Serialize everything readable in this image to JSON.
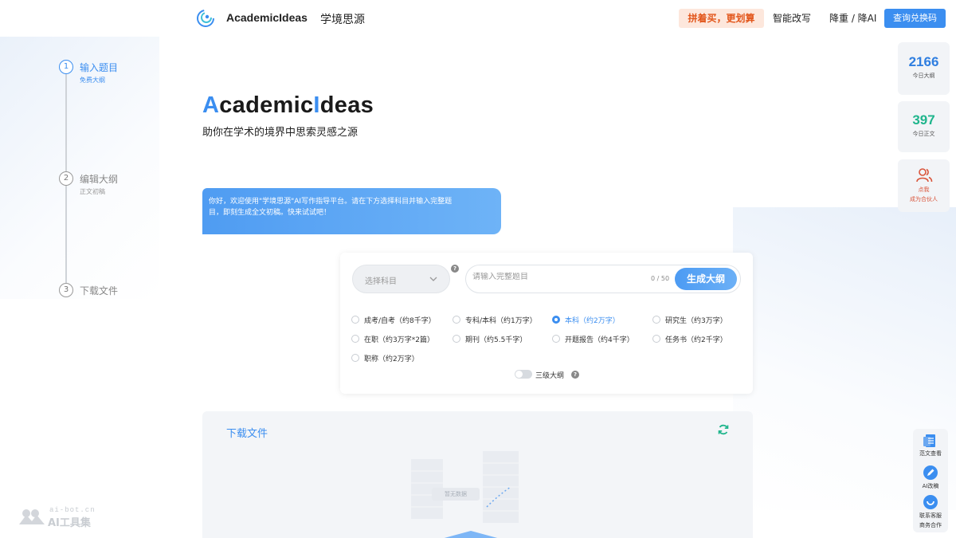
{
  "header": {
    "brand_en": "AcademicIdeas",
    "brand_cn": "学境思源",
    "nav_promo": "拼着买，更划算",
    "nav_rewrite": "智能改写",
    "nav_reduce": "降重 / 降AI",
    "nav_redeem": "查询兑换码"
  },
  "steps": [
    {
      "num": "1",
      "title": "输入题目",
      "sub": "免费大纲"
    },
    {
      "num": "2",
      "title": "编辑大纲",
      "sub": "正文初稿"
    },
    {
      "num": "3",
      "title": "下载文件",
      "sub": ""
    }
  ],
  "hero": {
    "title_accent_1": "A",
    "title_part_1": "cademic",
    "title_accent_2": "I",
    "title_part_2": "deas",
    "subtitle": "助你在学术的境界中思索灵感之源"
  },
  "welcome": {
    "line1": "你好，欢迎使用\"学境思源\"AI写作指导平台。请在下方选择科目并输入完整题",
    "line2": "目，即刻生成全文初稿。快来试试吧！"
  },
  "form": {
    "subject_placeholder": "选择科目",
    "title_placeholder": "请输入完整题目",
    "title_value": "",
    "char_count": "0 / 50",
    "generate_label": "生成大纲",
    "help_glyph": "?",
    "options": [
      {
        "label": "成考/自考（约8千字）",
        "checked": false
      },
      {
        "label": "专科/本科（约1万字）",
        "checked": false
      },
      {
        "label": "本科（约2万字）",
        "checked": true
      },
      {
        "label": "研究生（约3万字）",
        "checked": false
      },
      {
        "label": "在职（约3万字*2篇）",
        "checked": false
      },
      {
        "label": "期刊（约5.5千字）",
        "checked": false
      },
      {
        "label": "开题报告（约4千字）",
        "checked": false
      },
      {
        "label": "任务书（约2千字）",
        "checked": false
      },
      {
        "label": "职称（约2万字）",
        "checked": false
      }
    ],
    "toggle_label": "三级大纲",
    "toggle_on": false
  },
  "download": {
    "title": "下载文件",
    "empty_tip": "暂无数据"
  },
  "stats": {
    "outline_count": "2166",
    "outline_label": "今日大纲",
    "text_count": "397",
    "text_label": "今日正文",
    "partner_line1": "点我",
    "partner_line2": "成为合伙人"
  },
  "tools": {
    "samples": "范文查看",
    "ai_edit": "AI改稿",
    "support_line1": "联系客服",
    "support_line2": "商务合作"
  },
  "watermark": {
    "url": "ai-bot.cn",
    "text": "AI工具集"
  },
  "colors": {
    "accent": "#3b8ef0",
    "promo_text": "#e2561b",
    "promo_bg": "#fde7dc",
    "stat_green": "#1fb58c",
    "partner_red": "#d9543a"
  }
}
